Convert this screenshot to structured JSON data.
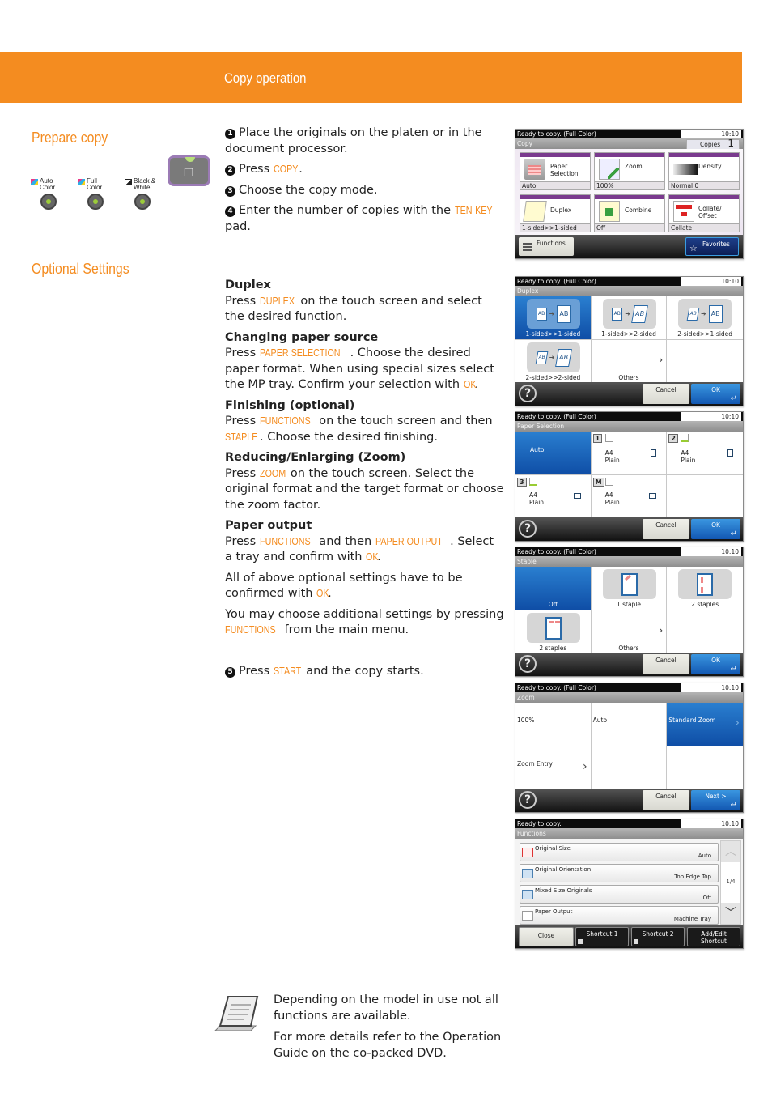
{
  "header": {
    "title": "Copy operation"
  },
  "sections": {
    "prepare_copy": "Prepare copy",
    "optional_settings": "Optional Settings"
  },
  "control_panel": {
    "modes": [
      {
        "label_line1": "Auto",
        "label_line2": "Color"
      },
      {
        "label_line1": "Full",
        "label_line2": "Color"
      },
      {
        "label_line1": "Black &",
        "label_line2": "White"
      }
    ],
    "copy_key": "copy-key"
  },
  "steps": {
    "s1": {
      "num": "1",
      "text": "Place the originals on the platen or in the document processor."
    },
    "s2": {
      "num": "2",
      "pre": "Press ",
      "kw": "COPY",
      "post": "."
    },
    "s3": {
      "num": "3",
      "text": "Choose the copy mode."
    },
    "s4": {
      "num": "4",
      "pre": "Enter the number of copies with the ",
      "kw": "TEN-KEY",
      "post": " pad."
    },
    "s5": {
      "num": "5",
      "pre": "Press ",
      "kw": "START",
      "post": " and the copy starts."
    }
  },
  "options": {
    "duplex": {
      "heading": "Duplex",
      "pre": "Press ",
      "kw": "DUPLEX",
      "post": " on the touch screen and select the desired function."
    },
    "paper": {
      "heading": "Changing paper source",
      "pre": "Press ",
      "kw": "PAPER SELECTION",
      "mid": ". Choose the desired paper format. When using special sizes select the MP tray. Confirm your selection with ",
      "kw2": "OK",
      "post": "."
    },
    "finishing": {
      "heading": "Finishing (optional)",
      "pre": "Press ",
      "kw": "FUNCTIONS",
      "mid": " on the touch screen and then ",
      "kw2": "STAPLE",
      "post": ". Choose the desired finishing."
    },
    "zoom": {
      "heading": "Reducing/Enlarging (Zoom)",
      "pre": "Press ",
      "kw": "ZOOM",
      "post": " on the touch screen. Select the original format and the target format or choose the zoom factor."
    },
    "output": {
      "heading": "Paper output",
      "pre": "Press ",
      "kw": "FUNCTIONS",
      "mid": " and then ",
      "kw2": "PAPER OUTPUT",
      "post": ". Select a tray and confirm with ",
      "kw3": "OK",
      "end": "."
    },
    "confirm": {
      "pre": "All of above optional settings have to be confirmed with ",
      "kw": "OK",
      "post": "."
    },
    "more": {
      "pre": "You may choose additional settings by pressing ",
      "kw": "FUNCTIONS",
      "post": " from the main menu."
    }
  },
  "screens": {
    "common": {
      "status": "Ready to copy. (Full Color)",
      "time": "10:10",
      "cancel": "Cancel",
      "ok": "OK",
      "enter_glyph": "↵",
      "help_glyph": "?"
    },
    "copy": {
      "title": "Copy",
      "copies_label": "Copies",
      "copies_value": "1",
      "buttons": [
        {
          "label": "Paper\nSelection",
          "l1": "Paper",
          "l2": "Selection",
          "value": "Auto"
        },
        {
          "l1": "Zoom",
          "l2": "",
          "value": "100%"
        },
        {
          "l1": "Density",
          "l2": "",
          "value": "Normal 0"
        },
        {
          "l1": "Duplex",
          "l2": "",
          "value": "1-sided>>1-sided"
        },
        {
          "l1": "Combine",
          "l2": "",
          "value": "Off"
        },
        {
          "l1": "Collate/",
          "l2": "Offset",
          "value": "Collate"
        }
      ],
      "functions": "Functions",
      "favorites": "Favorites"
    },
    "duplex": {
      "title": "Duplex",
      "options": [
        "1-sided>>1-sided",
        "1-sided>>2-sided",
        "2-sided>>1-sided",
        "2-sided>>2-sided",
        "Others"
      ],
      "selected": "1-sided>>1-sided"
    },
    "paper": {
      "title": "Paper Selection",
      "auto": "Auto",
      "trays": [
        {
          "id": "1",
          "size": "A4",
          "type": "Plain"
        },
        {
          "id": "2",
          "size": "A4",
          "type": "Plain"
        },
        {
          "id": "3",
          "size": "A4",
          "type": "Plain"
        },
        {
          "id": "M",
          "size": "A4",
          "type": "Plain"
        }
      ],
      "selected": "Auto"
    },
    "staple": {
      "title": "Staple",
      "options": [
        "Off",
        "1 staple",
        "2 staples",
        "2 staples",
        "Others"
      ],
      "selected": "Off"
    },
    "zoom": {
      "title": "Zoom",
      "options": [
        "100%",
        "Auto",
        "Standard Zoom",
        "Zoom Entry"
      ],
      "selected": "Standard Zoom",
      "next": "Next >"
    },
    "functions": {
      "status": "Ready to copy.",
      "title": "Functions",
      "items": [
        {
          "name": "Original Size",
          "value": "Auto"
        },
        {
          "name": "Original Orientation",
          "value": "Top Edge Top"
        },
        {
          "name": "Mixed Size Originals",
          "value": "Off"
        },
        {
          "name": "Paper Output",
          "value": "Machine Tray"
        }
      ],
      "page": "1/4",
      "close": "Close",
      "shortcut1": "Shortcut 1",
      "shortcut2": "Shortcut 2",
      "add_edit_l1": "Add/Edit",
      "add_edit_l2": "Shortcut"
    }
  },
  "note": {
    "p1": "Depending on the model in use not all functions are available.",
    "p2": "For more details refer to the Operation Guide on the co-packed DVD."
  },
  "colors": {
    "accent": "#f48c20",
    "selected_blue": "#1a64bc",
    "copy_purple": "#7a3a8e"
  }
}
